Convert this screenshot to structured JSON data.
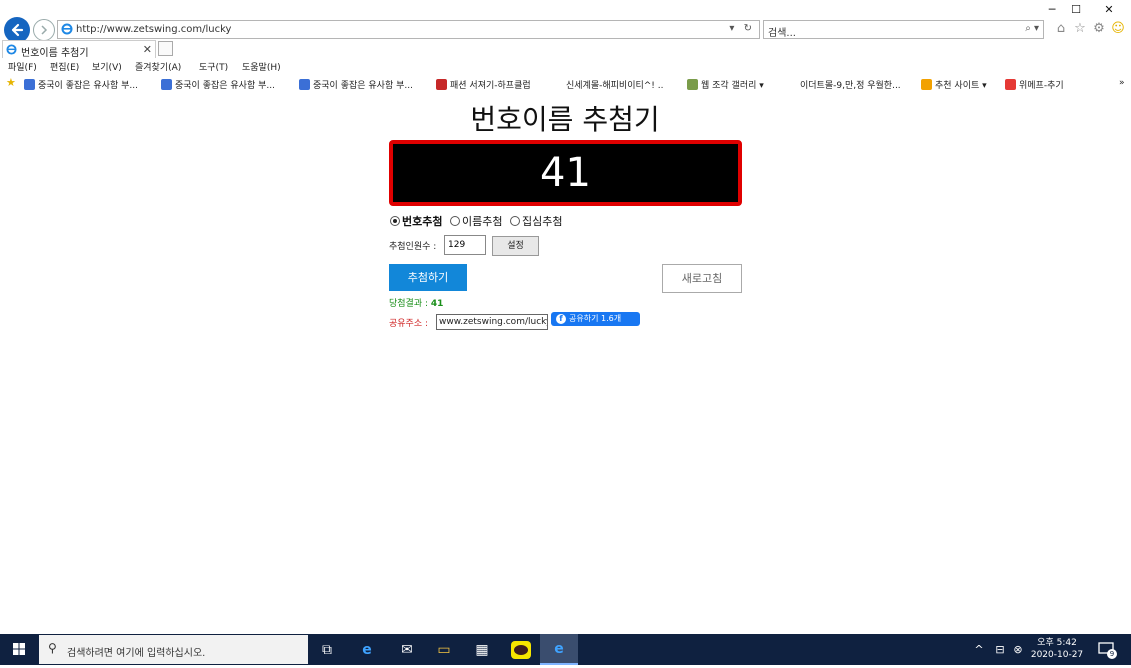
{
  "window": {
    "minimize": "─",
    "maximize": "☐",
    "close": "✕"
  },
  "browser": {
    "url": "http://www.zetswing.com/lucky",
    "search_placeholder": "검색...",
    "tab_title": "번호이름 추첨기",
    "menu": [
      "파일(F)",
      "편집(E)",
      "보기(V)",
      "즐겨찾기(A)",
      "도구(T)",
      "도움말(H)"
    ],
    "favorites": [
      "중국이 좋잡은 유사함 부...",
      "중국이 좋잡은 유사함 부...",
      "중국이 좋잡은 유사함 부...",
      "패션 서져기-하프클럽",
      "신세계몰-해피비이티^! ..",
      "웹 조각 갤러리 ▾",
      "이더트몰-9,만,정 우월한...",
      "추천 사이트 ▾",
      "위메프-추기"
    ],
    "overflow": "»"
  },
  "page": {
    "title": "번호이름 추첨기",
    "display_number": "41",
    "modes": [
      "번호추첨",
      "이름추첨",
      "집심추첨"
    ],
    "selected_mode": 0,
    "max_label": "추첨인원수 :",
    "max_value": "129",
    "set_button": "설정",
    "draw_button": "추첨하기",
    "refresh_button": "새로고침",
    "result_label": "당첨결과 :",
    "result_value": "41",
    "share_label": "공유주소 :",
    "share_url": "www.zetswing.com/lucky",
    "fb_button": "공유하기 1.6개"
  },
  "taskbar": {
    "search_placeholder": "검색하려면 여기에 입력하십시오.",
    "time": "오후 5:42",
    "date": "2020-10-27",
    "notification_count": "9"
  },
  "colors": {
    "display_border": "#e00000",
    "draw_button": "#1287d9",
    "result_text": "#1a8f1a",
    "share_label": "#d12a2a",
    "taskbar": "#0f2140"
  }
}
